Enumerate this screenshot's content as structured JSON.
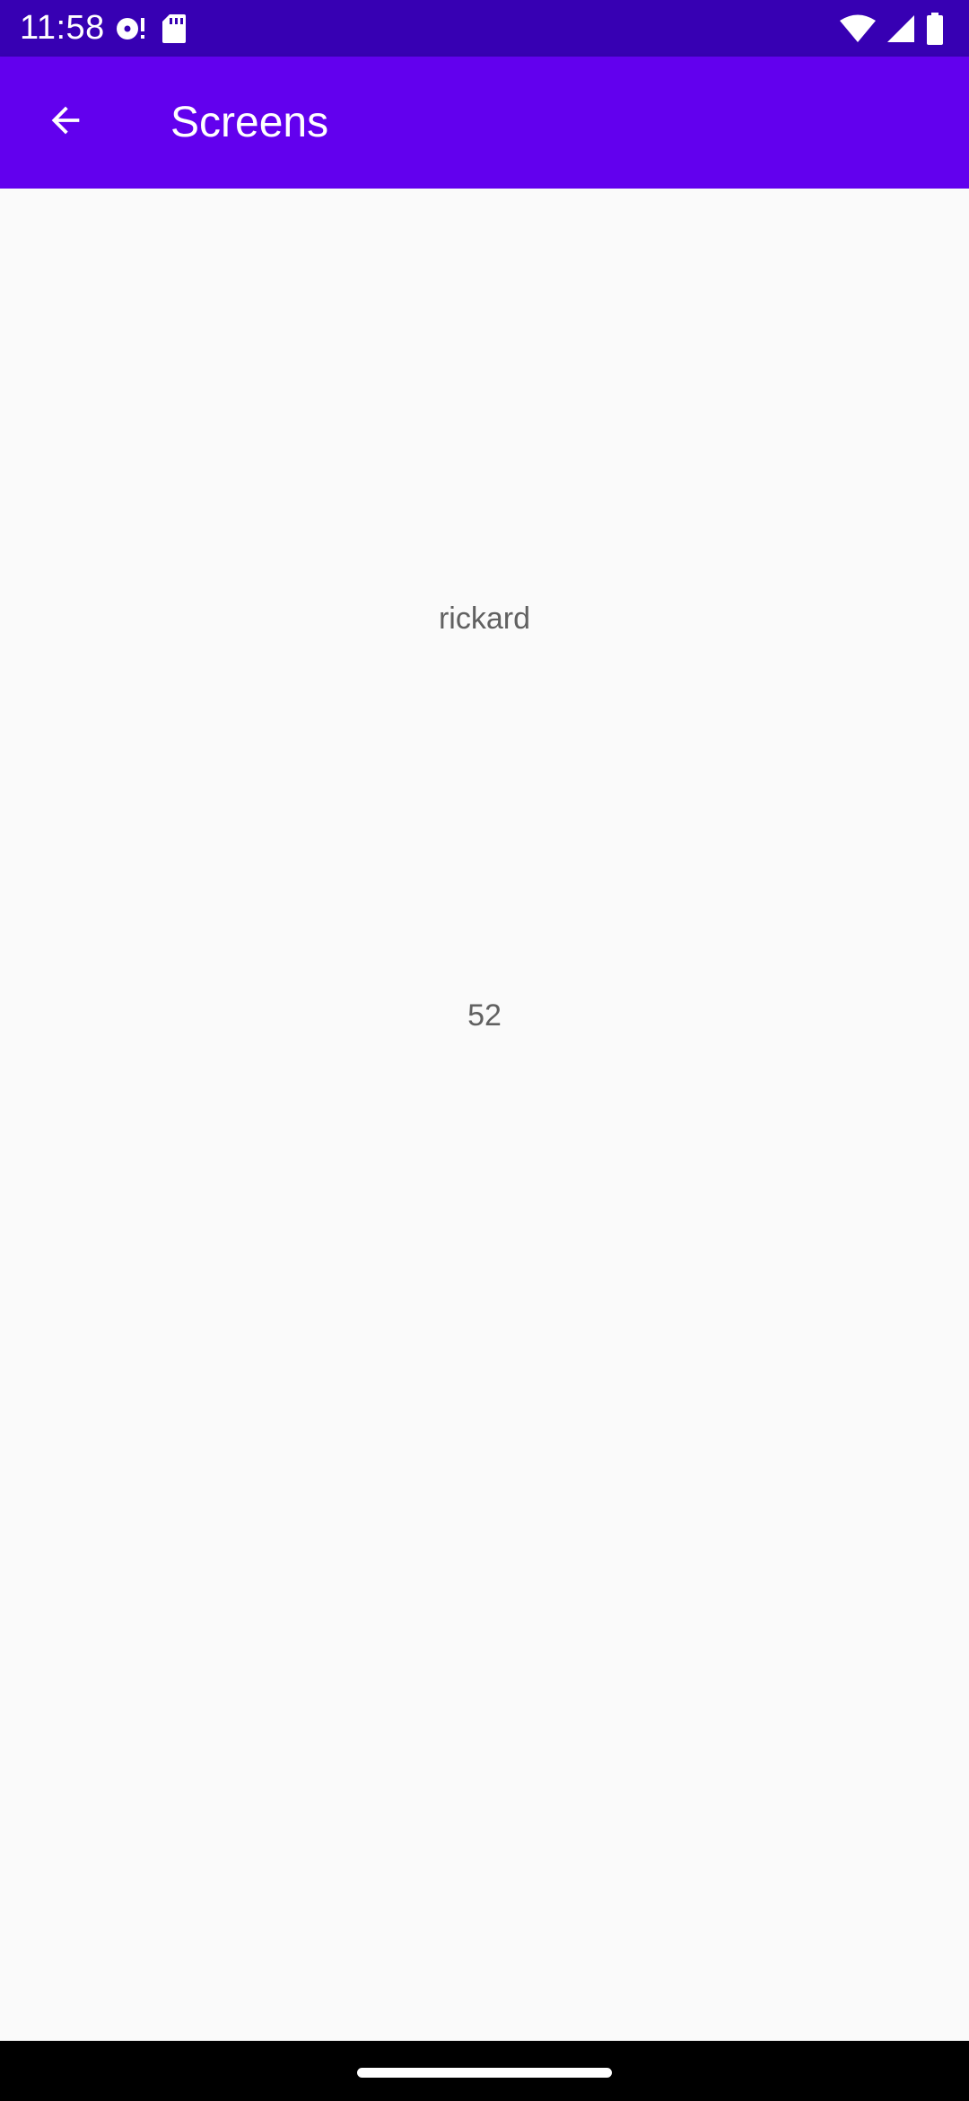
{
  "status_bar": {
    "time": "11:58",
    "left_icons": [
      "media-notification-icon",
      "sd-card-icon"
    ],
    "right_icons": [
      "wifi-icon",
      "cell-signal-icon",
      "battery-icon"
    ],
    "background": "#3700b3"
  },
  "app_bar": {
    "title": "Screens",
    "back_icon": "arrow-back-icon",
    "background": "#6200ee"
  },
  "content": {
    "name": "rickard",
    "number": "52"
  },
  "nav_bar": {
    "background": "#000000"
  }
}
